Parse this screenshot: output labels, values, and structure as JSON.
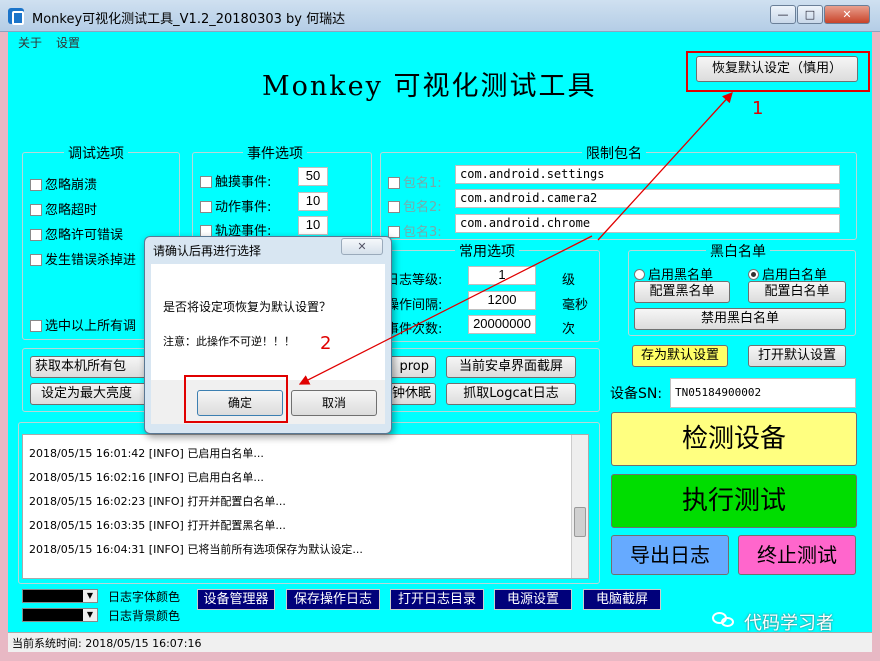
{
  "window": {
    "title": "Monkey可视化测试工具_V1.2_20180303 by 何瑞达",
    "min_label": "—",
    "max_label": "□",
    "close_label": "✕"
  },
  "menu": {
    "items": [
      "关于",
      "设置"
    ]
  },
  "app": {
    "heading": "Monkey 可视化测试工具",
    "restore_defaults": "恢复默认设定（慎用）"
  },
  "debug_options": {
    "label": "调试选项",
    "items": [
      "忽略崩溃",
      "忽略超时",
      "忽略许可错误",
      "发生错误杀掉进"
    ],
    "select_all": "选中以上所有调"
  },
  "event_options": {
    "label": "事件选项",
    "items": [
      {
        "label": "触摸事件:",
        "value": "50"
      },
      {
        "label": "动作事件:",
        "value": "10"
      },
      {
        "label": "轨迹事件:",
        "value": "10"
      }
    ]
  },
  "package_limit": {
    "label": "限制包名",
    "items": [
      {
        "label": "包名1:",
        "value": "com.android.settings"
      },
      {
        "label": "包名2:",
        "value": "com.android.camera2"
      },
      {
        "label": "包名3:",
        "value": "com.android.chrome"
      }
    ]
  },
  "common_options": {
    "label": "常用选项",
    "items": [
      {
        "label": "日志等级:",
        "value": "1",
        "unit": "级"
      },
      {
        "label": "操作间隔:",
        "value": "1200",
        "unit": "毫秒"
      },
      {
        "label": "事件次数:",
        "value": "20000000",
        "unit": "次"
      }
    ]
  },
  "blackwhite": {
    "label": "黑白名单",
    "radio_black": "启用黑名单",
    "radio_white": "启用白名单",
    "config_black": "配置黑名单",
    "config_white": "配置白名单",
    "disable": "禁用黑白名单"
  },
  "defaults": {
    "save": "存为默认设置",
    "open": "打开默认设置"
  },
  "device": {
    "label": "设备SN:",
    "sn": "TN05184900002"
  },
  "tools": {
    "get_packages": "获取本机所有包",
    "max_brightness": "设定为最大亮度",
    "prop": "prop",
    "screenshot": "当前安卓界面截屏",
    "sleep": "钟休眠",
    "logcat": "抓取Logcat日志"
  },
  "log": {
    "lines": [
      "2018/05/15 16:01:42 [INFO] 已启用白名单...",
      "2018/05/15 16:02:16 [INFO] 已启用白名单...",
      "2018/05/15 16:02:23 [INFO] 打开并配置白名单...",
      "2018/05/15 16:03:35 [INFO] 打开并配置黑名单...",
      "2018/05/15 16:04:31 [INFO] 已将当前所有选项保存为默认设定..."
    ]
  },
  "actions": {
    "detect": "检测设备",
    "run": "执行测试",
    "export": "导出日志",
    "stop": "终止测试"
  },
  "colors": {
    "font_color_label": "日志字体颜色",
    "bg_color_label": "日志背景颜色",
    "accent": "#00ffff",
    "detect_bg": "#ffff80",
    "run_bg": "#00dd00",
    "export_bg": "#66aaff",
    "stop_bg": "#ff66cc"
  },
  "bottom_buttons": [
    "设备管理器",
    "保存操作日志",
    "打开日志目录",
    "电源设置",
    "电脑截屏"
  ],
  "status": {
    "text": "当前系统时间: 2018/05/15 16:07:16"
  },
  "watermark": {
    "text": "代码学习者"
  },
  "dialog": {
    "title": "请确认后再进行选择",
    "close": "✕",
    "message": "是否将设定项恢复为默认设置？",
    "warning": "注意：此操作不可逆！！！",
    "ok": "确定",
    "cancel": "取消"
  },
  "callouts": {
    "one": "1",
    "two": "2"
  }
}
